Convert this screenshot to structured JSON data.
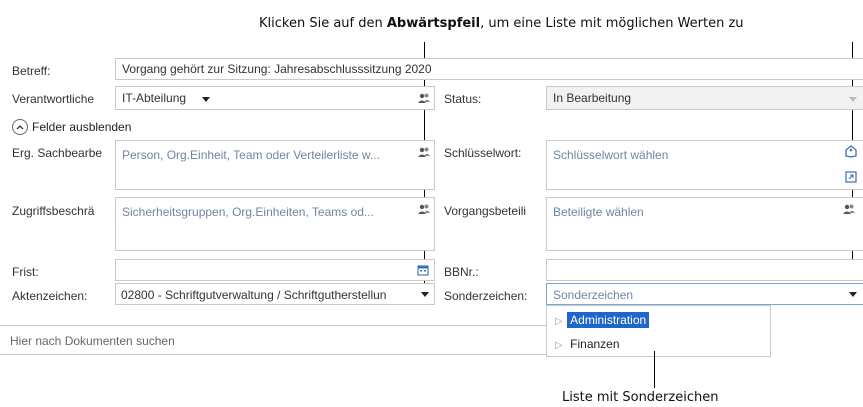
{
  "callouts": {
    "top_pre": "Klicken Sie auf den ",
    "top_bold": "Abwärtspfeil",
    "top_post": ", um eine Liste mit möglichen Werten zu",
    "bottom": "Liste mit Sonderzeichen"
  },
  "form": {
    "betreff": {
      "label": "Betreff:",
      "value": "Vorgang gehört zur Sitzung: Jahresabschlusssitzung 2020"
    },
    "verantwortliche": {
      "label": "Verantwortliche",
      "value": "IT-Abteilung"
    },
    "status": {
      "label": "Status:",
      "value": "In Bearbeitung"
    },
    "toggle_label": "Felder ausblenden",
    "erg_sachbearb": {
      "label": "Erg. Sachbearbe",
      "placeholder": "Person, Org.Einheit, Team oder Verteilerliste w..."
    },
    "schluesselwort": {
      "label": "Schlüsselwort:",
      "placeholder": "Schlüsselwort wählen"
    },
    "zugriffsbeschr": {
      "label": "Zugriffsbeschrä",
      "placeholder": "Sicherheitsgruppen, Org.Einheiten, Teams od..."
    },
    "vorgangsbeteil": {
      "label": "Vorgangsbeteili",
      "placeholder": "Beteiligte wählen"
    },
    "frist": {
      "label": "Frist:",
      "value": ""
    },
    "bbnr": {
      "label": "BBNr.:",
      "value": ""
    },
    "aktenzeichen": {
      "label": "Aktenzeichen:",
      "value": "02800 - Schriftgutverwaltung / Schriftgutherstellun"
    },
    "sonderzeichen": {
      "label": "Sonderzeichen:",
      "placeholder": "Sonderzeichen"
    },
    "search_placeholder": "Hier nach Dokumenten suchen"
  },
  "dropdown": {
    "items": [
      {
        "label": "Administration",
        "selected": true
      },
      {
        "label": "Finanzen",
        "selected": false
      }
    ]
  },
  "colors": {
    "selection": "#1e66c8",
    "placeholder": "#6f86a3"
  }
}
